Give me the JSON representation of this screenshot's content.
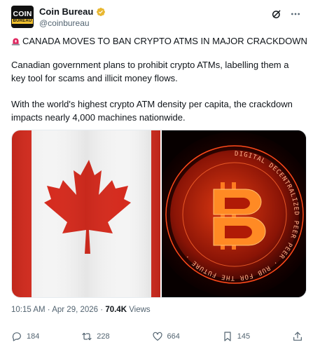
{
  "tweet": {
    "author": {
      "display_name": "Coin Bureau",
      "handle": "@coinbureau",
      "avatar_line1": "COIN",
      "avatar_line2": "BUREAU",
      "verified": true,
      "verified_color": "#e8b730"
    },
    "headline": "CANADA MOVES TO BAN CRYPTO ATMS IN MAJOR CRACKDOWN",
    "headline_icon": "siren-icon",
    "paragraph1": "Canadian government plans to prohibit crypto ATMs, labelling them a key tool for scams and illicit money flows.",
    "paragraph2": "With the world's highest crypto ATM density per capita, the crackdown impacts nearly 4,000 machines nationwide.",
    "media": {
      "left_image": "canada-flag",
      "right_image": "bitcoin-coin",
      "coin_ring_text": "DIGITAL DECENTRALIZED PEER PEER · RUB FOR THE FUTURE ·"
    },
    "meta": {
      "time": "10:15 AM",
      "date": "Apr 29, 2026",
      "separator": "·",
      "views_count": "70.4K",
      "views_label": "Views"
    },
    "actions": {
      "replies": "184",
      "reposts": "228",
      "likes": "664",
      "bookmarks": "145"
    },
    "colors": {
      "flag_red": "#d52b1e",
      "text_primary": "#0f1419",
      "text_secondary": "#536471"
    }
  }
}
